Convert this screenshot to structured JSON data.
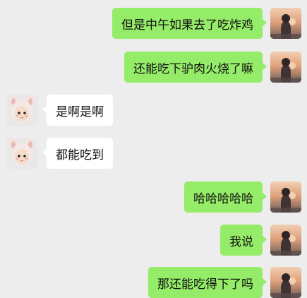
{
  "colors": {
    "background": "#EDEDED",
    "sent_bubble": "#95EC69",
    "received_bubble": "#FFFFFF",
    "text": "#111111"
  },
  "contacts": {
    "self_avatar_icon": "sunset-portrait-avatar-icon",
    "other_avatar_icon": "baby-bunny-hat-avatar-icon"
  },
  "messages": [
    {
      "direction": "sent",
      "text": "但是中午如果去了吃炸鸡"
    },
    {
      "direction": "sent",
      "text": "还能吃下驴肉火烧了嘛"
    },
    {
      "direction": "received",
      "text": "是啊是啊"
    },
    {
      "direction": "received",
      "text": "都能吃到"
    },
    {
      "direction": "sent",
      "text": "哈哈哈哈哈"
    },
    {
      "direction": "sent",
      "text": "我说"
    },
    {
      "direction": "sent",
      "text": "那还能吃得下了吗"
    }
  ]
}
